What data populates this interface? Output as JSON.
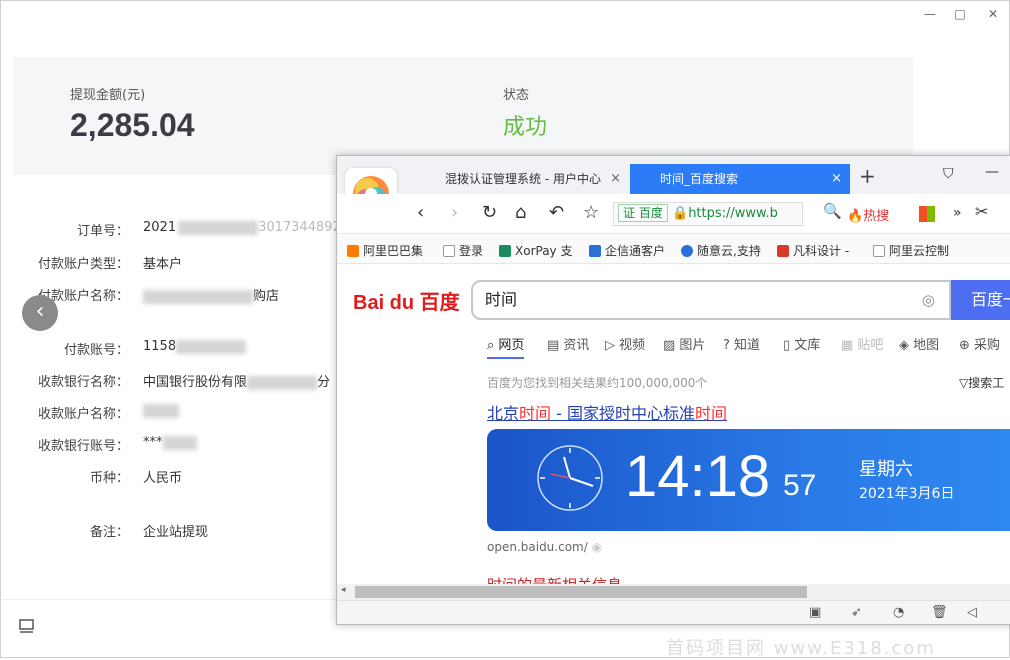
{
  "window_controls": {
    "min": "—",
    "max": "□",
    "close": "✕"
  },
  "summary": {
    "amount_label": "提现金额(元)",
    "amount": "2,285.04",
    "status_label": "状态",
    "status": "成功"
  },
  "details": [
    {
      "key": "订单号：",
      "value": "2021",
      "tail": "3017344892"
    },
    {
      "key": "付款账户类型：",
      "value": "基本户",
      "tail": ""
    },
    {
      "key": "付款账户名称：",
      "value": "",
      "tail": "购店"
    },
    {
      "key": "付款账号：",
      "value": "1158",
      "tail": ""
    },
    {
      "key": "收款银行名称：",
      "value": "中国银行股份有限",
      "tail": "分"
    },
    {
      "key": "收款账户名称：",
      "value": "",
      "tail": ""
    },
    {
      "key": "收款银行账号：",
      "value": "***",
      "tail": ""
    },
    {
      "key": "币种：",
      "value": "人民币",
      "tail": ""
    },
    {
      "key": "备注：",
      "value": "企业站提现",
      "tail": ""
    }
  ],
  "nav_prev": "‹",
  "browser": {
    "tabs": [
      {
        "label": "混拨认证管理系统 - 用户中心",
        "close": "×"
      },
      {
        "label": "时间_百度搜索",
        "close": "×"
      }
    ],
    "new_tab": "+",
    "address": {
      "cert": "百度",
      "url": "https://www.b"
    },
    "hot_search": "热搜",
    "bookmarks": [
      "阿里巴巴集",
      "登录",
      "XorPay 支",
      "企信通客户",
      "随意云,支持",
      "凡科设计 -",
      "阿里云控制"
    ],
    "baidu_logo": "Bai du 百度",
    "query": "时间",
    "search_btn": "百度一",
    "search_nav": [
      "网页",
      "资讯",
      "视频",
      "图片",
      "知道",
      "文库",
      "贴吧",
      "地图",
      "采购"
    ],
    "result_count": "百度为您找到相关结果约100,000,000个",
    "search_tools": "搜索工",
    "result_title": {
      "pre": "北京",
      "em1": "时间",
      "mid": " - 国家授时中心标准",
      "em2": "时间"
    },
    "clock": {
      "time": "14:18",
      "seconds": "57",
      "weekday": "星期六",
      "date": "2021年3月6日"
    },
    "result_source": "open.baidu.com/",
    "next_result": "时间的最新相关信息"
  },
  "watermark": "首码项目网 www.E318.com"
}
